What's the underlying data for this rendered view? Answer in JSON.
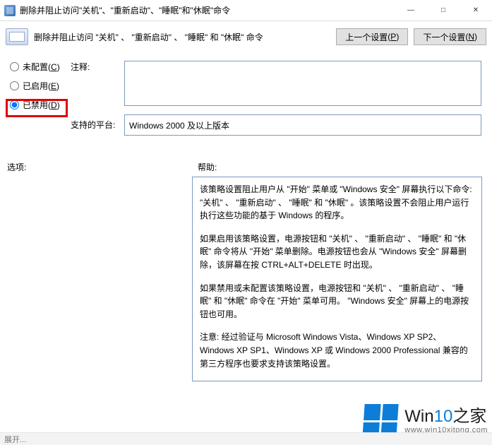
{
  "window": {
    "title": "删除并阻止访问\"关机\"、\"重新启动\"、\"睡眠\"和\"休眠\"命令",
    "min_glyph": "—",
    "max_glyph": "□",
    "close_glyph": "✕"
  },
  "header": {
    "subtitle": "删除并阻止访问 \"关机\" 、 \"重新启动\" 、 \"睡眠\" 和 \"休眠\" 命令",
    "prev_label": "上一个设置",
    "prev_accel": "P",
    "next_label": "下一个设置",
    "next_accel": "N"
  },
  "radios": {
    "not_configured": "未配置",
    "not_configured_accel": "C",
    "enabled": "已启用",
    "enabled_accel": "E",
    "disabled": "已禁用",
    "disabled_accel": "D"
  },
  "labels": {
    "comment": "注释:",
    "platform": "支持的平台:",
    "options": "选项:",
    "help": "帮助:"
  },
  "fields": {
    "comment_value": "",
    "platform_value": "Windows 2000 及以上版本"
  },
  "help": {
    "p1": "该策略设置阻止用户从 \"开始\" 菜单或 \"Windows 安全\" 屏幕执行以下命令: \"关机\" 、 \"重新启动\" 、 \"睡眠\" 和 \"休眠\" 。该策略设置不会阻止用户运行执行这些功能的基于 Windows 的程序。",
    "p2": "如果启用该策略设置，电源按钮和 \"关机\" 、 \"重新启动\" 、 \"睡眠\" 和 \"休眠\" 命令将从 \"开始\" 菜单删除。电源按钮也会从 \"Windows 安全\" 屏幕删除，该屏幕在按 CTRL+ALT+DELETE 时出现。",
    "p3": "如果禁用或未配置该策略设置，电源按钮和 \"关机\" 、 \"重新启动\" 、 \"睡眠\" 和 \"休眠\" 命令在 \"开始\" 菜单可用。 \"Windows 安全\" 屏幕上的电源按钮也可用。",
    "p4": "注意: 经过验证与 Microsoft Windows Vista、Windows XP SP2、Windows XP SP1、Windows XP 或 Windows 2000 Professional 兼容的第三方程序也要求支持该策略设置。"
  },
  "watermark": {
    "brand_a": "Win",
    "brand_b": "10",
    "brand_c": "之家",
    "url": "www.win10xitong.com"
  },
  "footer": {
    "text": "展开..."
  }
}
